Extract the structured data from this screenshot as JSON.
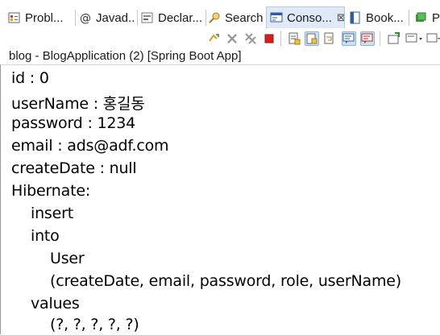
{
  "tabs": [
    {
      "label": "Probl...",
      "icon": "problems-icon"
    },
    {
      "label": "Javad...",
      "icon": "javadoc-icon"
    },
    {
      "label": "Declar...",
      "icon": "declaration-icon"
    },
    {
      "label": "Search",
      "icon": "search-icon"
    },
    {
      "label": "Conso...",
      "icon": "console-icon",
      "active": true,
      "close": "⊠"
    },
    {
      "label": "Book...",
      "icon": "bookmarks-icon"
    },
    {
      "label": "Pr",
      "icon": "progress-icon"
    }
  ],
  "console": {
    "title": "blog - BlogApplication (2) [Spring Boot App]",
    "lines": [
      "id : 0",
      "userName : 홍길동",
      "password : 1234",
      "email : ads@adf.com",
      "createDate : null",
      "Hibernate:",
      "insert",
      "into",
      "User",
      "(createDate, email, password, role, userName)",
      "values",
      "(?, ?, ?, ?, ?)"
    ]
  },
  "colors": {
    "active_tab": "#dfe9f7",
    "terminate_red": "#d62020"
  }
}
